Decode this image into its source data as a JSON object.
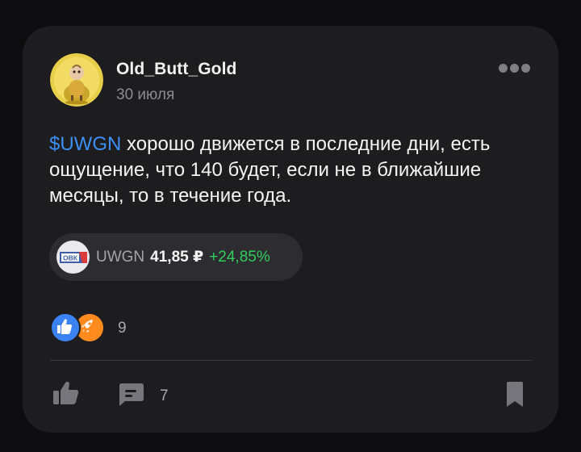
{
  "post": {
    "author": "Old_Butt_Gold",
    "date": "30 июля",
    "ticker_link": "$UWGN",
    "text": " хорошо движется в последние дни, есть ощущение, что 140 будет, если не в ближайшие месяцы, то в течение года."
  },
  "instrument": {
    "logo_text": "ОВК",
    "ticker": "UWGN",
    "price": "41,85 ₽",
    "change": "+24,85%",
    "change_color": "#2fcf5a"
  },
  "reactions": {
    "types": [
      "thumbs-up-icon",
      "rocket-icon"
    ],
    "count": "9"
  },
  "actions": {
    "comments_count": "7"
  },
  "colors": {
    "background": "#0d0d0f",
    "card": "#1d1d20",
    "link": "#3d8ff3"
  }
}
